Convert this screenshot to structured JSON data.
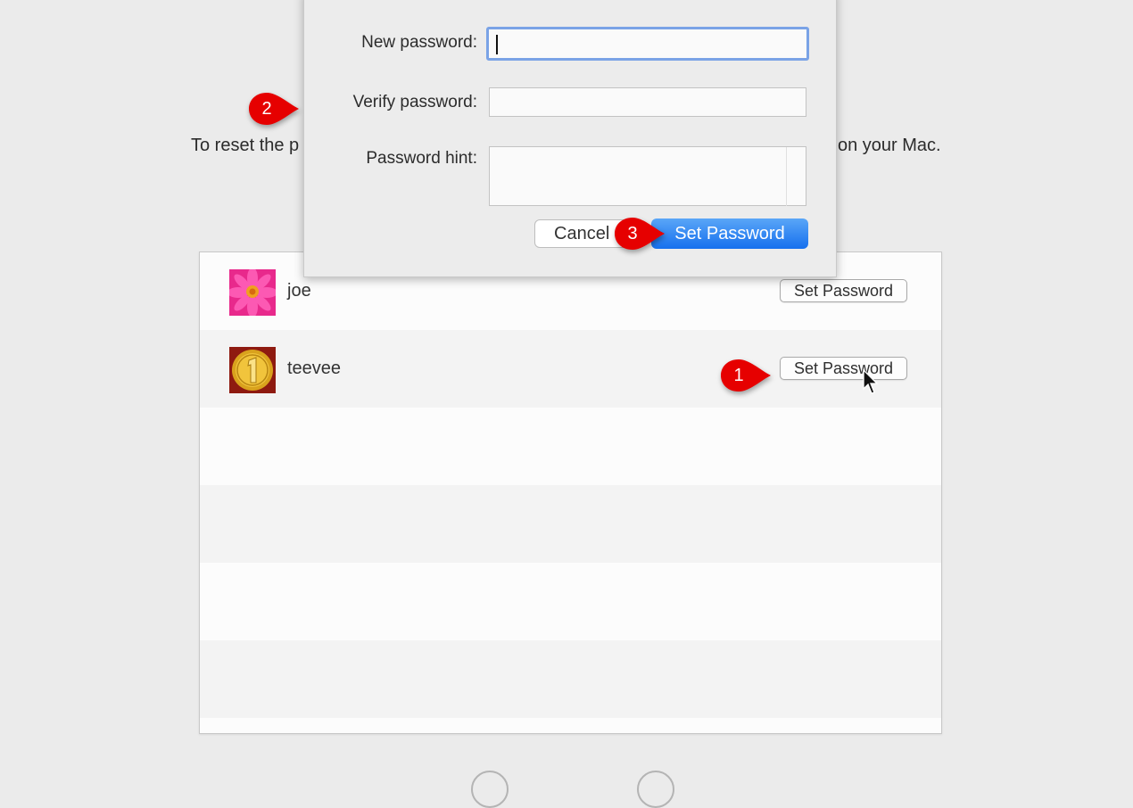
{
  "instruction": {
    "visible_left": "To reset the p",
    "visible_right": "on your Mac."
  },
  "dialog": {
    "new_password": {
      "label": "New password:",
      "value": "",
      "focused": true
    },
    "verify_password": {
      "label": "Verify password:",
      "value": ""
    },
    "password_hint": {
      "label": "Password hint:",
      "value": ""
    },
    "cancel_label": "Cancel",
    "set_password_label": "Set Password"
  },
  "users": [
    {
      "name": "joe",
      "avatar": "pink-flower-icon",
      "button_label": "Set Password"
    },
    {
      "name": "teevee",
      "avatar": "gold-medal-icon",
      "button_label": "Set Password"
    }
  ],
  "empty_rows": 4,
  "annotations": [
    {
      "number": "1",
      "target": "teevee Set Password button"
    },
    {
      "number": "2",
      "target": "Verify password field"
    },
    {
      "number": "3",
      "target": "dialog Set Password button"
    }
  ],
  "colors": {
    "accent": "#1670ee",
    "focus_ring": "#7aa3e6",
    "annotation": "#e60000",
    "background": "#ebebeb"
  }
}
